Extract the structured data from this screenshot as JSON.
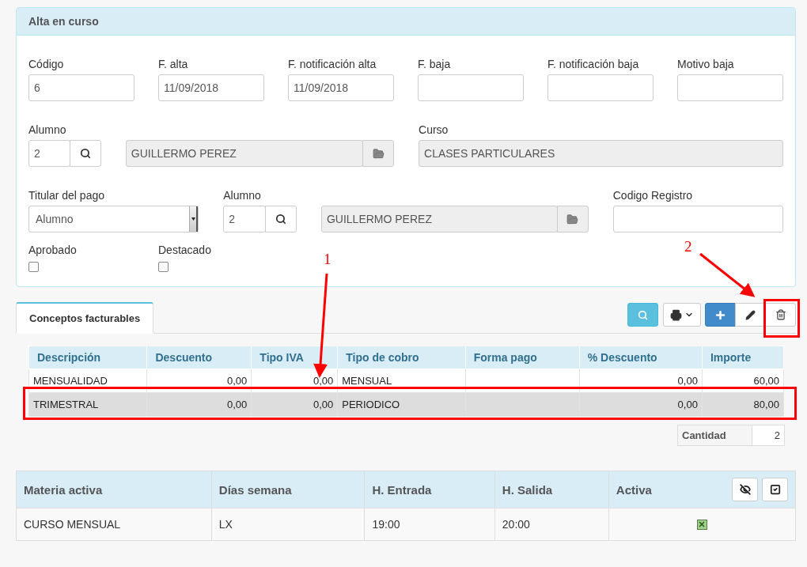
{
  "panel": {
    "title": "Alta en curso"
  },
  "fields": [
    {
      "label": "Código",
      "value": "6"
    },
    {
      "label": "F. alta",
      "value": "11/09/2018"
    },
    {
      "label": "F. notificación alta",
      "value": "11/09/2018"
    },
    {
      "label": "F. baja"
    },
    {
      "label": "F. notificación baja"
    },
    {
      "label": "Motivo baja"
    }
  ],
  "alumno": {
    "label": "Alumno",
    "code": "2",
    "name": "GUILLERMO PEREZ"
  },
  "curso": {
    "label": "Curso",
    "value": "CLASES PARTICULARES"
  },
  "titular": {
    "label": "Titular del pago",
    "value": "Alumno"
  },
  "alumno_pago": {
    "label": "Alumno",
    "code": "2",
    "name": "GUILLERMO PEREZ"
  },
  "codigo_registro": {
    "label": "Codigo Registro"
  },
  "checkboxes": [
    {
      "label": "Aprobado",
      "checked": false
    },
    {
      "label": "Destacado",
      "checked": false
    }
  ],
  "tabs": [
    {
      "label": "Conceptos facturables",
      "selected": true
    }
  ],
  "table": {
    "columns": [
      {
        "label": "Descripción",
        "kind": "text"
      },
      {
        "label": "Descuento",
        "kind": "number"
      },
      {
        "label": "Tipo IVA",
        "kind": "number"
      },
      {
        "label": "Tipo de cobro",
        "kind": "text"
      },
      {
        "label": "Forma pago",
        "kind": "text"
      },
      {
        "label": "% Descuento",
        "kind": "number"
      },
      {
        "label": "Importe",
        "kind": "number"
      }
    ],
    "rows": [
      {
        "selected": false,
        "cells": [
          "MENSUALIDAD",
          "0,00",
          "0,00",
          "MENSUAL",
          null,
          "0,00",
          "60,00"
        ]
      },
      {
        "selected": true,
        "cells": [
          "TRIMESTRAL",
          "0,00",
          "0,00",
          "PERIODICO",
          null,
          "0,00",
          "80,00"
        ]
      }
    ]
  },
  "summary": {
    "label": "Cantidad",
    "value": "2"
  },
  "schedule": {
    "columns": [
      "Materia activa",
      "Días semana",
      "H. Entrada",
      "H. Salida",
      "Activa"
    ],
    "rows": [
      {
        "cells": [
          "CURSO MENSUAL",
          "LX",
          "19:00",
          "20:00"
        ],
        "active": true
      }
    ]
  },
  "annotations": [
    {
      "label": "1"
    },
    {
      "label": "2"
    }
  ]
}
